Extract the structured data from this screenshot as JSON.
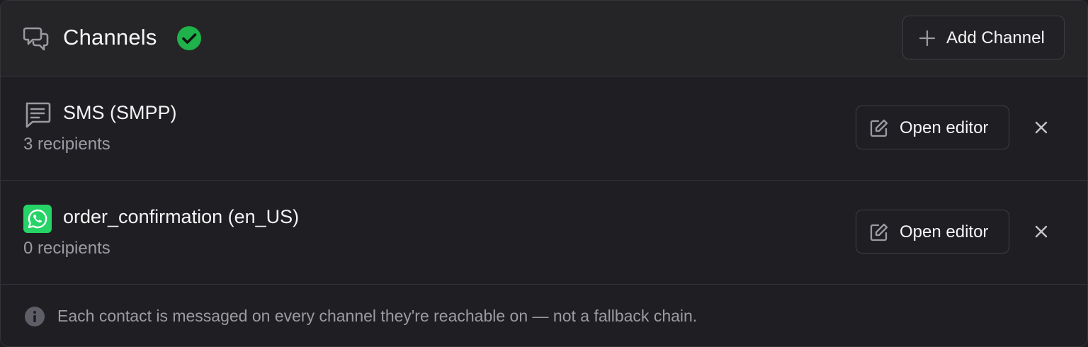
{
  "header": {
    "title": "Channels",
    "icon": "chat-bubbles-icon",
    "status_icon": "check-circle-icon",
    "status_color": "#1fb14a",
    "add_button_label": "Add Channel"
  },
  "channels": [
    {
      "icon": "message-lines-icon",
      "title": "SMS (SMPP)",
      "subtitle": "3 recipients",
      "edit_label": "Open editor"
    },
    {
      "icon": "whatsapp-icon",
      "icon_color": "#25d366",
      "title": "order_confirmation (en_US)",
      "subtitle": "0 recipients",
      "edit_label": "Open editor"
    }
  ],
  "footer": {
    "icon": "info-icon",
    "text": "Each contact is messaged on every channel they're reachable on — not a fallback chain."
  }
}
